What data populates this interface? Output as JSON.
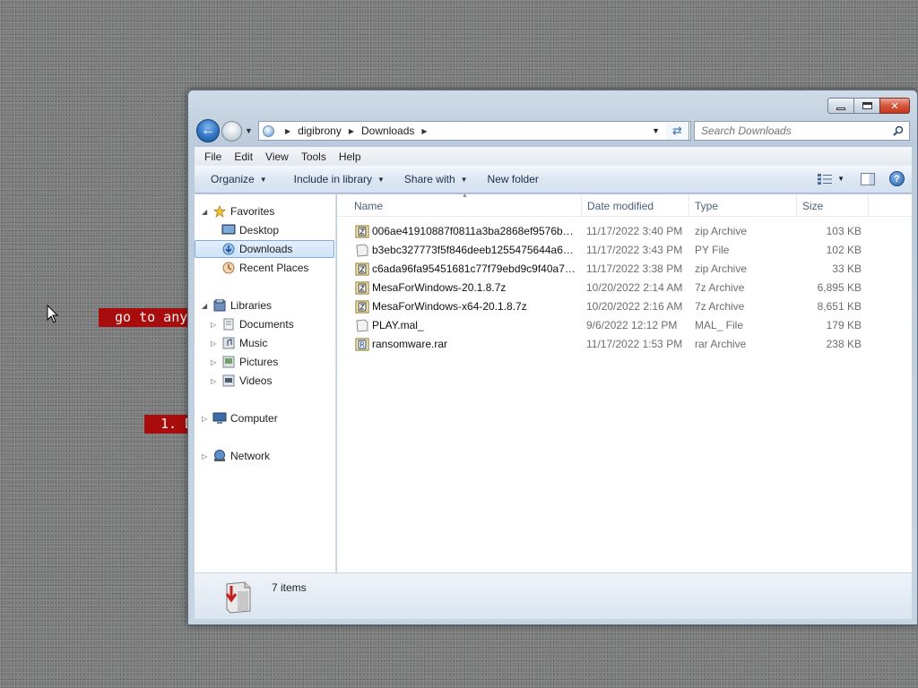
{
  "desktop": {
    "banner_1": "go to any",
    "banner_2": "1. D"
  },
  "window": {
    "caption": {
      "minimize": "minimize",
      "maximize": "maximize",
      "close": "✕"
    }
  },
  "address": {
    "crumbs": [
      "digibrony",
      "Downloads"
    ]
  },
  "search": {
    "placeholder": "Search Downloads"
  },
  "menu": [
    "File",
    "Edit",
    "View",
    "Tools",
    "Help"
  ],
  "commands": {
    "organize": "Organize",
    "include_library": "Include in library",
    "share_with": "Share with",
    "new_folder": "New folder"
  },
  "nav": {
    "favorites": "Favorites",
    "desktop": "Desktop",
    "downloads": "Downloads",
    "recent_places": "Recent Places",
    "libraries": "Libraries",
    "documents": "Documents",
    "music": "Music",
    "pictures": "Pictures",
    "videos": "Videos",
    "computer": "Computer",
    "network": "Network"
  },
  "columns": {
    "name": "Name",
    "date_modified": "Date modified",
    "type": "Type",
    "size": "Size"
  },
  "files": [
    {
      "name": "006ae41910887f0811a3ba2868ef9576bbd2...",
      "date": "11/17/2022 3:40 PM",
      "type": "zip Archive",
      "size": "103 KB",
      "icon": "archive-icon"
    },
    {
      "name": "b3ebc327773f5f846deeb1255475644a630c...",
      "date": "11/17/2022 3:43 PM",
      "type": "PY File",
      "size": "102 KB",
      "icon": "generic-file-icon"
    },
    {
      "name": "c6ada96fa95451681c77f79ebd9c9f40a7a0...",
      "date": "11/17/2022 3:38 PM",
      "type": "zip Archive",
      "size": "33 KB",
      "icon": "archive-icon"
    },
    {
      "name": "MesaForWindows-20.1.8.7z",
      "date": "10/20/2022 2:14 AM",
      "type": "7z Archive",
      "size": "6,895 KB",
      "icon": "archive-icon"
    },
    {
      "name": "MesaForWindows-x64-20.1.8.7z",
      "date": "10/20/2022 2:16 AM",
      "type": "7z Archive",
      "size": "8,651 KB",
      "icon": "archive-icon"
    },
    {
      "name": "PLAY.mal_",
      "date": "9/6/2022 12:12 PM",
      "type": "MAL_ File",
      "size": "179 KB",
      "icon": "generic-file-icon"
    },
    {
      "name": "ransomware.rar",
      "date": "11/17/2022 1:53 PM",
      "type": "rar Archive",
      "size": "238 KB",
      "icon": "rar-archive-icon"
    }
  ],
  "status": {
    "count": "7 items"
  },
  "colors": {
    "banner_red": "#a80c0c",
    "selection": "#cfe3f8",
    "back_button": "#2a6fc0"
  }
}
